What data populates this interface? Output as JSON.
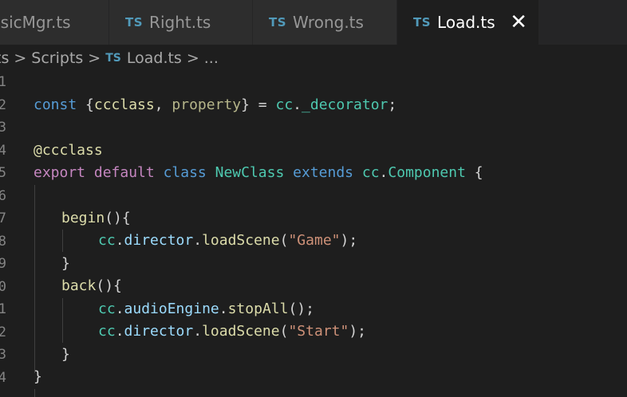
{
  "tabs": [
    {
      "label": "usicMgr.ts",
      "icon": "ts-icon"
    },
    {
      "label": "Right.ts",
      "icon": "ts-icon"
    },
    {
      "label": "Wrong.ts",
      "icon": "ts-icon"
    },
    {
      "label": "Load.ts",
      "icon": "ts-icon",
      "active": true,
      "close": "✕"
    }
  ],
  "ts_badge": "TS",
  "breadcrumb": {
    "items": [
      "ts",
      "Scripts",
      "Load.ts",
      "..."
    ],
    "separator": ">"
  },
  "gutter": [
    "1",
    "2",
    "3",
    "4",
    "5",
    "6",
    "7",
    "8",
    "9",
    "0",
    "1",
    "2",
    "3",
    "4"
  ],
  "code": {
    "l2": {
      "a": "const",
      "b": " {",
      "c": "ccclass",
      "d": ", ",
      "e": "property",
      "f": "} = ",
      "g": "cc",
      "h": ".",
      "i": "_decorator",
      "j": ";"
    },
    "l4": {
      "a": "@ccclass"
    },
    "l5": {
      "a": "export",
      "b": " ",
      "c": "default",
      "d": " ",
      "e": "class",
      "f": " ",
      "g": "NewClass",
      "h": " ",
      "i": "extends",
      "j": " ",
      "k": "cc",
      "l": ".",
      "m": "Component",
      "n": " {"
    },
    "l7": {
      "a": "begin",
      "b": "(){"
    },
    "l8": {
      "a": "cc",
      "b": ".",
      "c": "director",
      "d": ".",
      "e": "loadScene",
      "f": "(",
      "g": "\"Game\"",
      "h": ");"
    },
    "l9": {
      "a": "}"
    },
    "l10": {
      "a": "back",
      "b": "(){"
    },
    "l11": {
      "a": "cc",
      "b": ".",
      "c": "audioEngine",
      "d": ".",
      "e": "stopAll",
      "f": "();"
    },
    "l12": {
      "a": "cc",
      "b": ".",
      "c": "director",
      "d": ".",
      "e": "loadScene",
      "f": "(",
      "g": "\"Start\"",
      "h": ");"
    },
    "l13": {
      "a": "}"
    },
    "l14": {
      "a": "}"
    }
  },
  "colors": {
    "background": "#1e1e1e",
    "tab_inactive": "#2d2d2d",
    "ts_icon": "#519aba",
    "keyword": "#569cd6",
    "control": "#c586c0",
    "type": "#4ec9b0",
    "function": "#dcdcaa",
    "variable": "#9cdcfe",
    "string": "#ce9178"
  }
}
